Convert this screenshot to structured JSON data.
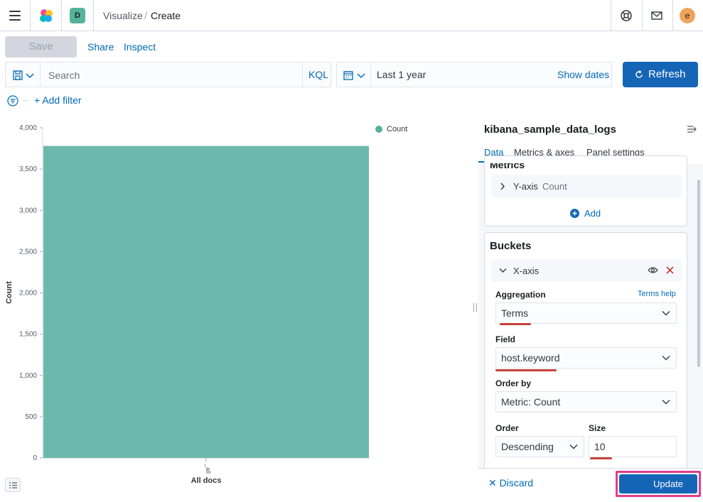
{
  "header": {
    "space_initial": "D",
    "breadcrumbs": [
      "Visualize",
      "Create"
    ],
    "avatar_initial": "e"
  },
  "toolbar": {
    "save_label": "Save",
    "share_label": "Share",
    "inspect_label": "Inspect"
  },
  "query": {
    "search_placeholder": "Search",
    "language": "KQL",
    "date_range": "Last 1 year",
    "show_dates_label": "Show dates",
    "refresh_label": "Refresh",
    "add_filter_label": "+ Add filter"
  },
  "chart_data": {
    "type": "bar",
    "categories": [
      "All docs"
    ],
    "x_tick_label": "_all",
    "series": [
      {
        "name": "Count",
        "values": [
          3780
        ]
      }
    ],
    "ylabel": "Count",
    "xlabel": "",
    "ylim": [
      0,
      4000
    ],
    "yticks": [
      "0",
      "500",
      "1,000",
      "1,500",
      "2,000",
      "2,500",
      "3,000",
      "3,500",
      "4,000"
    ],
    "bar_color": "#6db8ad",
    "legend_position": "top-right"
  },
  "panel": {
    "index_title": "kibana_sample_data_logs",
    "tabs": [
      "Data",
      "Metrics & axes",
      "Panel settings"
    ],
    "active_tab": "Data",
    "metrics": {
      "title": "Metrics",
      "y_axis_label": "Y-axis",
      "y_axis_value": "Count",
      "add_label": "Add"
    },
    "buckets": {
      "title": "Buckets",
      "x_axis_label": "X-axis",
      "aggregation_label": "Aggregation",
      "terms_help_label": "Terms help",
      "aggregation_value": "Terms",
      "field_label": "Field",
      "field_value": "host.keyword",
      "order_by_label": "Order by",
      "order_by_value": "Metric: Count",
      "order_label": "Order",
      "order_value": "Descending",
      "size_label": "Size",
      "size_value": "10"
    },
    "discard_label": "Discard",
    "update_label": "Update"
  },
  "colors": {
    "accent": "#006bb8",
    "primary_button": "#1565b7",
    "bar": "#6db8ad",
    "annotation_red": "#c8413b"
  }
}
